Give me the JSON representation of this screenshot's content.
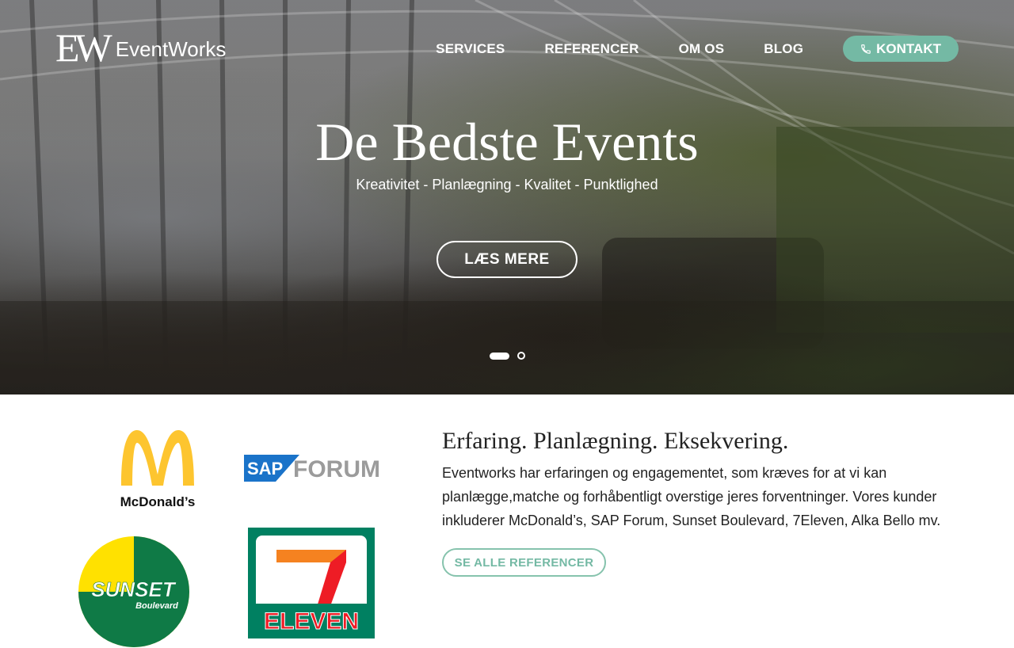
{
  "brand": {
    "mark": "EW",
    "name": "EventWorks"
  },
  "nav": {
    "items": [
      {
        "label": "SERVICES"
      },
      {
        "label": "REFERENCER"
      },
      {
        "label": "OM OS"
      },
      {
        "label": "BLOG"
      }
    ],
    "cta_label": "KONTAKT",
    "cta_icon": "phone-icon",
    "accent": "#74b9a4"
  },
  "hero": {
    "title": "De Bedste Events",
    "subtitle": "Kreativitet - Planlægning - Kvalitet - Punktlighed",
    "button_label": "LÆS MERE",
    "slides_total": 2,
    "slide_active": 1
  },
  "clients": {
    "logos": [
      {
        "name": "McDonald's",
        "text": "McDonald’s"
      },
      {
        "name": "SAP Forum",
        "text_sap": "SAP",
        "text_forum": "FORUM"
      },
      {
        "name": "Sunset Boulevard",
        "text_main": "SUNSET",
        "text_sub": "Boulevard"
      },
      {
        "name": "7-Eleven",
        "text": "ELEVEN"
      }
    ]
  },
  "about": {
    "title": "Erfaring. Planlægning. Eksekvering.",
    "body": "Eventworks har erfaringen og engagementet, som kræves for at vi kan planlægge,matche og forhåbentligt overstige jeres forventninger. Vores kunder inkluderer McDonald’s, SAP Forum, Sunset Boulevard, 7Eleven, Alka Bello mv.",
    "button_label": "SE ALLE REFERENCER"
  }
}
